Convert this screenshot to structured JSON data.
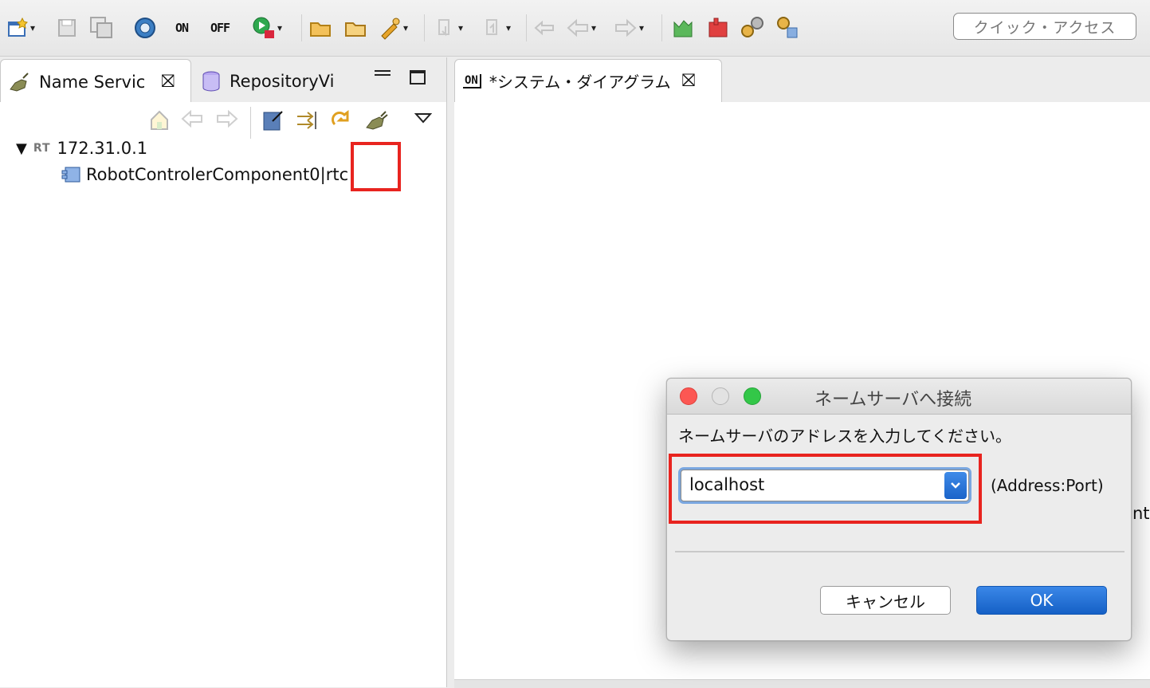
{
  "toolbar": {
    "on_label": "ON",
    "off_label": "OFF",
    "quick_access_placeholder": "クイック・アクセス"
  },
  "left_view": {
    "tabs": [
      {
        "label": "Name Servic"
      },
      {
        "label": "RepositoryVi"
      }
    ],
    "tree": [
      {
        "prefix": "RT",
        "label": "172.31.0.1"
      },
      {
        "label": "RobotControlerComponent0|rtc"
      }
    ]
  },
  "editor": {
    "tab_label": "*システム・ダイアグラム",
    "tab_icon_text": "ON",
    "clipped_text": "nt"
  },
  "dialog": {
    "title": "ネームサーバへ接続",
    "message": "ネームサーバのアドレスを入力してください。",
    "combo_value": "localhost",
    "suffix": "(Address:Port)",
    "cancel_label": "キャンセル",
    "ok_label": "OK"
  },
  "colors": {
    "highlight_red": "#e8241f",
    "accent_blue": "#1a63c9"
  }
}
